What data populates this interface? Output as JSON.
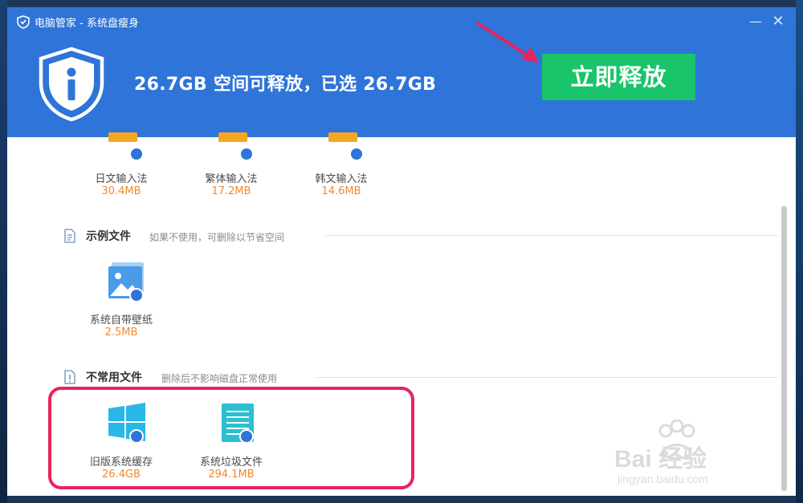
{
  "window": {
    "title": "电脑管家 - 系统盘瘦身",
    "minimize_label": "—",
    "close_label": "✕"
  },
  "header": {
    "headline": "26.7GB 空间可释放，已选 26.7GB",
    "release_button": "立即释放"
  },
  "top_row": [
    {
      "name": "日文输入法",
      "size": "30.4MB"
    },
    {
      "name": "繁体输入法",
      "size": "17.2MB"
    },
    {
      "name": "韩文输入法",
      "size": "14.6MB"
    }
  ],
  "sections": [
    {
      "title": "示例文件",
      "subtitle": "如果不使用，可删除以节省空间",
      "items": [
        {
          "name": "系统自带壁纸",
          "size": "2.5MB",
          "icon": "wallpaper-icon"
        }
      ]
    },
    {
      "title": "不常用文件",
      "subtitle": "删除后不影响磁盘正常使用",
      "items": [
        {
          "name": "旧版系统缓存",
          "size": "26.4GB",
          "icon": "windows-icon"
        },
        {
          "name": "系统垃圾文件",
          "size": "294.1MB",
          "icon": "document-icon"
        }
      ]
    }
  ],
  "watermark": {
    "brand": "Bai 经验",
    "url": "jingyan.baidu.com"
  },
  "colors": {
    "header_bg": "#2f74d8",
    "release_button": "#19c46a",
    "size_text": "#f0892e",
    "highlight": "#e8245c",
    "arrow": "#e8245c"
  }
}
